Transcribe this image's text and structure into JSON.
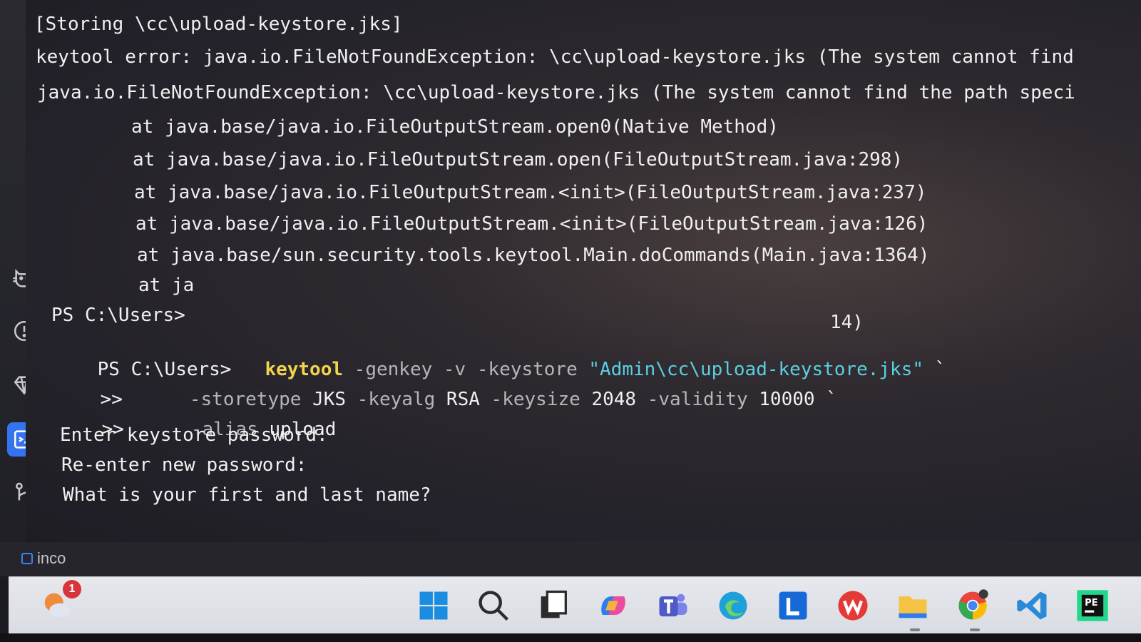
{
  "terminal": {
    "lines": [
      {
        "text": "[Storing \\cc\\upload-keystore.jks]"
      },
      {
        "text": "keytool error: java.io.FileNotFoundException: \\cc\\upload-keystore.jks (The system cannot find"
      },
      {
        "text": "java.io.FileNotFoundException: \\cc\\upload-keystore.jks (The system cannot find the path speci"
      },
      {
        "text": "at java.base/java.io.FileOutputStream.open0(Native Method)"
      },
      {
        "text": "at java.base/java.io.FileOutputStream.open(FileOutputStream.java:298)"
      },
      {
        "text": "at java.base/java.io.FileOutputStream.<init>(FileOutputStream.java:237)"
      },
      {
        "text": "at java.base/java.io.FileOutputStream.<init>(FileOutputStream.java:126)"
      },
      {
        "text": "at java.base/sun.security.tools.keytool.Main.doCommands(Main.java:1364)"
      },
      {
        "text": "at ja"
      },
      {
        "text": "PS C:\\Users>"
      },
      {
        "text": "14)"
      }
    ],
    "command": {
      "prompt": "PS C:\\Users>",
      "cmd": "keytool",
      "args1": "-genkey -v -keystore",
      "path": "\"Admin\\cc\\upload-keystore.jks\"",
      "tick1": "`",
      "cont1": ">>",
      "args2a": "-storetype",
      "args2b": "JKS",
      "args2c": "-keyalg",
      "args2d": "RSA",
      "args2e": "-keysize",
      "args2f": "2048",
      "args2g": "-validity",
      "args2h": "10000",
      "tick2": "`",
      "cont2": ">>",
      "args3a": "-alias",
      "args3b": "upload"
    },
    "prompts": [
      "Enter keystore password:",
      "Re-enter new password:",
      "What is your first and last name?"
    ]
  },
  "statusbar": {
    "item": "inco"
  },
  "sidebar": {
    "tools": [
      "cat-icon",
      "problems-icon",
      "gem-icon",
      "terminal-icon",
      "git-branch-icon"
    ]
  },
  "taskbar": {
    "weather_badge": "1",
    "pycharm_label": "PE",
    "apps": [
      "weather",
      "start",
      "search",
      "task-view",
      "copilot",
      "teams",
      "edge",
      "l-app",
      "wps",
      "file-explorer",
      "chrome",
      "vscode",
      "pycharm"
    ]
  }
}
